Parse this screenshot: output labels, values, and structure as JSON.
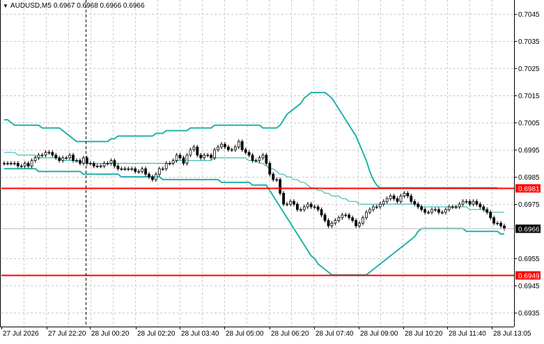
{
  "header": {
    "symbol": "AUDUSD,M5",
    "ohlc": "0.6967 0.6968 0.6966 0.6966"
  },
  "colors": {
    "background": "#ffffff",
    "grid": "#c8c8c8",
    "candle": "#000000",
    "bollinger": "#20b2aa",
    "level_line": "#ff0000",
    "level_label_bg": "#ff0000",
    "price_label_bg": "#000000"
  },
  "chart_data": {
    "type": "candlestick",
    "timeframe": "M5",
    "ylim": [
      0.693,
      0.705
    ],
    "y_ticks": [
      "0.7045",
      "0.7035",
      "0.7025",
      "0.7015",
      "0.7005",
      "0.6995",
      "0.6985",
      "0.6975",
      "0.6955",
      "0.6945",
      "0.6935"
    ],
    "x_ticks": [
      "27 Jul 2026",
      "27 Jul 22:20",
      "28 Jul 00:20",
      "28 Jul 02:20",
      "28 Jul 03:40",
      "28 Jul 05:00",
      "28 Jul 06:20",
      "28 Jul 07:40",
      "28 Jul 09:00",
      "28 Jul 10:20",
      "28 Jul 11:40",
      "28 Jul 13:05"
    ],
    "levels": [
      {
        "value": 0.6981,
        "label": "0.6981"
      },
      {
        "value": 0.6949,
        "label": "0.6949"
      }
    ],
    "current_price": {
      "value": 0.6966,
      "label": "0.6966"
    },
    "crosshair_x_index": 2,
    "indicator": "Bollinger Bands",
    "close": [
      0.699,
      0.699,
      0.699,
      0.699,
      0.6989,
      0.6989,
      0.699,
      0.6989,
      0.6991,
      0.6992,
      0.6993,
      0.6993,
      0.6994,
      0.6994,
      0.6993,
      0.6992,
      0.6991,
      0.6992,
      0.6992,
      0.6993,
      0.6991,
      0.6991,
      0.699,
      0.6992,
      0.699,
      0.699,
      0.6989,
      0.6989,
      0.6989,
      0.699,
      0.699,
      0.6991,
      0.6989,
      0.6988,
      0.6988,
      0.6988,
      0.6988,
      0.6988,
      0.6987,
      0.6987,
      0.6988,
      0.6986,
      0.6985,
      0.6984,
      0.6986,
      0.6988,
      0.6988,
      0.699,
      0.699,
      0.6991,
      0.6993,
      0.6992,
      0.699,
      0.6993,
      0.6995,
      0.6996,
      0.6993,
      0.6992,
      0.6993,
      0.6993,
      0.6992,
      0.6995,
      0.6996,
      0.6997,
      0.6996,
      0.6995,
      0.6995,
      0.6996,
      0.6998,
      0.6995,
      0.6994,
      0.6993,
      0.6991,
      0.6991,
      0.6992,
      0.6993,
      0.699,
      0.6986,
      0.6984,
      0.6984,
      0.6979,
      0.6975,
      0.6975,
      0.6976,
      0.6975,
      0.6973,
      0.6973,
      0.6974,
      0.6975,
      0.6974,
      0.6974,
      0.6973,
      0.6971,
      0.6969,
      0.6967,
      0.6968,
      0.6969,
      0.697,
      0.6971,
      0.6971,
      0.697,
      0.6969,
      0.6967,
      0.6968,
      0.697,
      0.6972,
      0.6973,
      0.6974,
      0.6974,
      0.6975,
      0.6976,
      0.6977,
      0.6978,
      0.6977,
      0.6976,
      0.6978,
      0.6979,
      0.6978,
      0.6976,
      0.6975,
      0.6974,
      0.6973,
      0.6972,
      0.6972,
      0.6973,
      0.6973,
      0.6972,
      0.6972,
      0.6973,
      0.6974,
      0.6974,
      0.6974,
      0.6975,
      0.6976,
      0.6976,
      0.6975,
      0.6976,
      0.6975,
      0.6974,
      0.6973,
      0.6972,
      0.697,
      0.6968,
      0.6968,
      0.6967,
      0.6966
    ],
    "upper_band": [
      0.7006,
      0.7006,
      0.7005,
      0.7004,
      0.7004,
      0.7004,
      0.7004,
      0.7004,
      0.7004,
      0.7004,
      0.7004,
      0.7003,
      0.7003,
      0.7003,
      0.7003,
      0.7003,
      0.7003,
      0.7002,
      0.7001,
      0.7,
      0.6999,
      0.6998,
      0.6998,
      0.6998,
      0.6998,
      0.6998,
      0.6998,
      0.6998,
      0.6998,
      0.6998,
      0.6998,
      0.6999,
      0.6999,
      0.7,
      0.7,
      0.7,
      0.7,
      0.7,
      0.7,
      0.7,
      0.7,
      0.7,
      0.7,
      0.7,
      0.7001,
      0.7001,
      0.7001,
      0.7002,
      0.7002,
      0.7002,
      0.7002,
      0.7002,
      0.7002,
      0.7002,
      0.7003,
      0.7003,
      0.7003,
      0.7003,
      0.7003,
      0.7003,
      0.7003,
      0.7004,
      0.7004,
      0.7004,
      0.7004,
      0.7004,
      0.7004,
      0.7004,
      0.7004,
      0.7004,
      0.7004,
      0.7004,
      0.7004,
      0.7004,
      0.7004,
      0.7003,
      0.7003,
      0.7003,
      0.7003,
      0.7003,
      0.7004,
      0.7006,
      0.7008,
      0.7009,
      0.701,
      0.7011,
      0.7012,
      0.7014,
      0.7015,
      0.7016,
      0.7016,
      0.7016,
      0.7016,
      0.7016,
      0.7015,
      0.7014,
      0.7012,
      0.701,
      0.7008,
      0.7006,
      0.7004,
      0.7002,
      0.7,
      0.6997,
      0.6994,
      0.6991,
      0.6987,
      0.6984,
      0.6982,
      0.6981,
      0.6981,
      0.6981,
      0.6981,
      0.6981,
      0.6981,
      0.6981,
      0.6981,
      0.6981,
      0.6981,
      0.6981,
      0.6981,
      0.6981,
      0.6981,
      0.6981,
      0.6981,
      0.6981,
      0.6981,
      0.6981,
      0.6981,
      0.6981,
      0.6981,
      0.6981,
      0.6981,
      0.6981,
      0.6981,
      0.6981,
      0.6981,
      0.6981,
      0.6981,
      0.6981,
      0.6981,
      0.6981,
      0.6981,
      0.6981
    ],
    "middle_band": [
      0.6994,
      0.6994,
      0.6994,
      0.6994,
      0.6993,
      0.6993,
      0.6993,
      0.6993,
      0.6993,
      0.6993,
      0.6992,
      0.6992,
      0.6992,
      0.6992,
      0.6992,
      0.6992,
      0.6992,
      0.6991,
      0.6991,
      0.6991,
      0.6991,
      0.6991,
      0.6991,
      0.699,
      0.699,
      0.699,
      0.699,
      0.699,
      0.699,
      0.699,
      0.699,
      0.699,
      0.699,
      0.699,
      0.699,
      0.699,
      0.699,
      0.699,
      0.699,
      0.699,
      0.699,
      0.699,
      0.699,
      0.699,
      0.699,
      0.699,
      0.699,
      0.699,
      0.699,
      0.699,
      0.6991,
      0.6991,
      0.6991,
      0.6991,
      0.6991,
      0.6991,
      0.6991,
      0.6991,
      0.6991,
      0.6991,
      0.6991,
      0.6992,
      0.6992,
      0.6992,
      0.6992,
      0.6992,
      0.6992,
      0.6992,
      0.6992,
      0.6992,
      0.6992,
      0.6991,
      0.6991,
      0.6991,
      0.699,
      0.699,
      0.6989,
      0.6988,
      0.6988,
      0.6987,
      0.6986,
      0.6986,
      0.6985,
      0.6985,
      0.6984,
      0.6984,
      0.6983,
      0.6983,
      0.6982,
      0.6981,
      0.6981,
      0.698,
      0.698,
      0.6979,
      0.6979,
      0.6978,
      0.6978,
      0.6978,
      0.6977,
      0.6977,
      0.6976,
      0.6976,
      0.6976,
      0.6975,
      0.6975,
      0.6975,
      0.6975,
      0.6975,
      0.6975,
      0.6975,
      0.6975,
      0.6975,
      0.6975,
      0.6975,
      0.6975,
      0.6975,
      0.6975,
      0.6975,
      0.6975,
      0.6975,
      0.6975,
      0.6974,
      0.6974,
      0.6974,
      0.6974,
      0.6974,
      0.6974,
      0.6974,
      0.6974,
      0.6974,
      0.6974,
      0.6974,
      0.6974,
      0.6974,
      0.6974,
      0.6973,
      0.6973,
      0.6973,
      0.6973,
      0.6973,
      0.6972,
      0.6972,
      0.6972,
      0.6972,
      0.6972,
      0.6972
    ],
    "lower_band": [
      0.6988,
      0.6988,
      0.6988,
      0.6988,
      0.6988,
      0.6988,
      0.6988,
      0.6988,
      0.6988,
      0.6988,
      0.6987,
      0.6987,
      0.6987,
      0.6987,
      0.6987,
      0.6987,
      0.6987,
      0.6987,
      0.6987,
      0.6987,
      0.6987,
      0.6987,
      0.6987,
      0.6986,
      0.6986,
      0.6986,
      0.6986,
      0.6986,
      0.6986,
      0.6986,
      0.6986,
      0.6986,
      0.6986,
      0.6986,
      0.6985,
      0.6985,
      0.6985,
      0.6985,
      0.6985,
      0.6985,
      0.6985,
      0.6985,
      0.6985,
      0.6985,
      0.6985,
      0.6985,
      0.6984,
      0.6984,
      0.6984,
      0.6984,
      0.6984,
      0.6984,
      0.6984,
      0.6984,
      0.6984,
      0.6984,
      0.6984,
      0.6984,
      0.6984,
      0.6984,
      0.6984,
      0.6984,
      0.6984,
      0.6983,
      0.6983,
      0.6983,
      0.6983,
      0.6983,
      0.6983,
      0.6983,
      0.6983,
      0.6983,
      0.6982,
      0.6982,
      0.6982,
      0.6982,
      0.6982,
      0.698,
      0.6978,
      0.6976,
      0.6974,
      0.6972,
      0.697,
      0.6968,
      0.6966,
      0.6964,
      0.6962,
      0.696,
      0.6958,
      0.6956,
      0.6955,
      0.6953,
      0.6952,
      0.6951,
      0.695,
      0.6949,
      0.6949,
      0.6949,
      0.6949,
      0.6949,
      0.6949,
      0.6949,
      0.6949,
      0.6949,
      0.6949,
      0.6949,
      0.695,
      0.6951,
      0.6952,
      0.6953,
      0.6954,
      0.6955,
      0.6956,
      0.6957,
      0.6958,
      0.6959,
      0.696,
      0.6961,
      0.6962,
      0.6963,
      0.6965,
      0.6966,
      0.6966,
      0.6966,
      0.6966,
      0.6966,
      0.6966,
      0.6966,
      0.6966,
      0.6966,
      0.6966,
      0.6966,
      0.6966,
      0.6966,
      0.6965,
      0.6965,
      0.6965,
      0.6965,
      0.6965,
      0.6965,
      0.6965,
      0.6965,
      0.6965,
      0.6965,
      0.6964,
      0.6964
    ]
  }
}
